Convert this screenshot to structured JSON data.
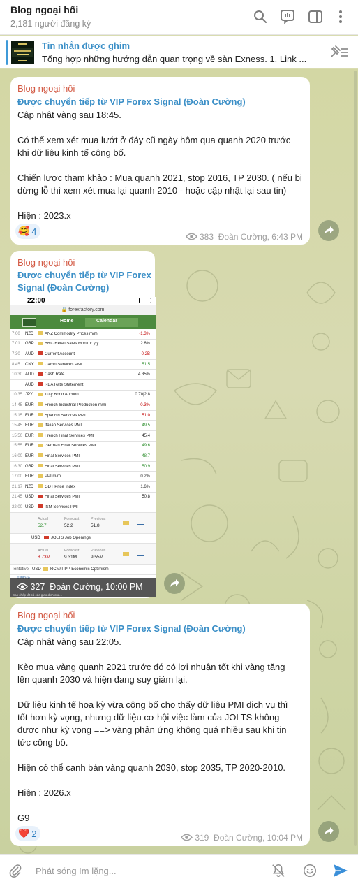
{
  "header": {
    "title": "Blog ngoại hối",
    "subtitle": "2,181 người đăng ký"
  },
  "pinned": {
    "title": "Tin nhắn được ghim",
    "text": "Tổng hợp những hướng dẫn quan trọng về sàn Exness.  1. Link ..."
  },
  "messages": [
    {
      "sender": "Blog ngoại hối",
      "forward": "Được chuyển tiếp từ VIP Forex Signal (Đoàn Cường)",
      "lines": [
        "Cập nhật vàng sau 18:45.",
        "",
        "Có thể xem xét mua lướt ở đáy cũ ngày hôm qua quanh 2020 trước",
        "khi dữ liệu kinh tế công bố.",
        "",
        "Chiến lược tham khảo : Mua quanh 2021, stop 2016, TP 2030. ( nếu bị",
        "dừng lỗ thì xem xét mua lại quanh 2010 - hoặc cập nhật lại sau tin)",
        "",
        "Hiện : 2023.x"
      ],
      "reaction_emoji": "🥰",
      "reaction_count": "4",
      "views": "383",
      "author_time": "Đoàn Cường, 6:43 PM"
    },
    {
      "sender": "Blog ngoại hối",
      "forward_line1": "Được chuyển tiếp từ VIP Forex",
      "forward_line2": "Signal (Đoàn Cường)",
      "views": "327",
      "author_time": "Đoàn Cường, 10:00 PM"
    },
    {
      "sender": "Blog ngoại hối",
      "forward": "Được chuyển tiếp từ VIP Forex Signal (Đoàn Cường)",
      "lines": [
        "Cập nhật vàng sau 22:05.",
        "",
        "Kèo mua vàng quanh 2021 trước đó có lợi nhuận tốt khi vàng tăng",
        "lên quanh 2030 và hiện đang suy giảm lại.",
        "",
        "Dữ liệu kinh tế hoa kỳ vừa công bố  cho thấy dữ liệu PMI dịch vụ thì",
        "tốt hơn kỳ vọng, nhưng dữ liệu cơ hội việc làm của JOLTS không",
        "được như kỳ vọng ==> vàng phản ứng không quá nhiều sau khi tin",
        "tức công bố.",
        "",
        "Hiện có thể canh bán vàng quanh 2030, stop 2035, TP 2020-2010.",
        "",
        "Hiện : 2026.x",
        "",
        "G9"
      ],
      "reaction_emoji": "❤️",
      "reaction_count": "2",
      "views": "319",
      "author_time": "Đoàn Cường, 10:04 PM"
    }
  ],
  "screenshot": {
    "time": "22:00",
    "url": "forexfactory.com",
    "nav_home": "Home",
    "nav_calendar": "Calendar",
    "more": "More",
    "rows": [
      {
        "t": "7:00",
        "c": "NZD",
        "e": "ANZ Commodity Prices m/m",
        "v": "-1.3%",
        "color": "#c00000"
      },
      {
        "t": "7:01",
        "c": "GBP",
        "e": "BRC Retail Sales Monitor y/y",
        "v": "2.6%",
        "color": "#222222"
      },
      {
        "t": "7:30",
        "c": "AUD",
        "e": "Current Account",
        "v": "-0.2B",
        "color": "#c00000"
      },
      {
        "t": "8:45",
        "c": "CNY",
        "e": "Caixin Services PMI",
        "v": "51.5",
        "color": "#2f8f2f"
      },
      {
        "t": "10:30",
        "c": "AUD",
        "e": "Cash Rate",
        "v": "4.35%",
        "color": "#222222"
      },
      {
        "t": "",
        "c": "AUD",
        "e": "RBA Rate Statement",
        "v": "",
        "color": "#222222"
      },
      {
        "t": "10:35",
        "c": "JPY",
        "e": "10-y Bond Auction",
        "v": "0.70|2.8",
        "color": "#222222"
      },
      {
        "t": "14:45",
        "c": "EUR",
        "e": "French Industrial Production m/m",
        "v": "-0.3%",
        "color": "#c00000"
      },
      {
        "t": "15:15",
        "c": "EUR",
        "e": "Spanish Services PMI",
        "v": "51.0",
        "color": "#c00000"
      },
      {
        "t": "15:45",
        "c": "EUR",
        "e": "Italian Services PMI",
        "v": "49.5",
        "color": "#2f8f2f"
      },
      {
        "t": "15:50",
        "c": "EUR",
        "e": "French Final Services PMI",
        "v": "45.4",
        "color": "#222222"
      },
      {
        "t": "15:55",
        "c": "EUR",
        "e": "German Final Services PMI",
        "v": "49.6",
        "color": "#2f8f2f"
      },
      {
        "t": "16:00",
        "c": "EUR",
        "e": "Final Services PMI",
        "v": "48.7",
        "color": "#2f8f2f"
      },
      {
        "t": "16:30",
        "c": "GBP",
        "e": "Final Services PMI",
        "v": "50.9",
        "color": "#2f8f2f"
      },
      {
        "t": "17:00",
        "c": "EUR",
        "e": "PPI m/m",
        "v": "0.2%",
        "color": "#222222"
      },
      {
        "t": "21:17",
        "c": "NZD",
        "e": "GDT Price Index",
        "v": "1.6%",
        "color": "#222222"
      },
      {
        "t": "21:45",
        "c": "USD",
        "e": "Final Services PMI",
        "v": "50.8",
        "color": "#222222"
      },
      {
        "t": "22:00",
        "c": "USD",
        "e": "ISM Services PMI",
        "v": "",
        "color": "#222222"
      }
    ],
    "ism_detail": {
      "actual_label": "Actual",
      "forecast_label": "Forecast",
      "previous_label": "Previous",
      "actual": "52.7",
      "forecast": "52.2",
      "previous": "51.8"
    },
    "jolts_row": {
      "c": "USD",
      "e": "JOLTS Job Openings"
    },
    "jolts_detail": {
      "actual_label": "Actual",
      "forecast_label": "Forecast",
      "previous_label": "Previous",
      "actual": "8.73M",
      "forecast": "9.31M",
      "previous": "9.55M"
    },
    "tentative_row": {
      "t": "Tentative",
      "c": "USD",
      "e": "RCM/TIPP Economic Optimism"
    },
    "caption": "Sao chép tất cả các giao dịch của..."
  },
  "input": {
    "placeholder": "Phát sóng Im lặng..."
  },
  "colors": {
    "accent": "#3b8fc7",
    "sender": "#d35a44",
    "chat_bg": "#d3d7a4",
    "send": "#3a8fd9"
  }
}
